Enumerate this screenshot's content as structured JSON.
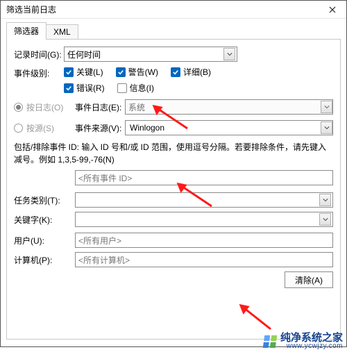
{
  "window": {
    "title": "筛选当前日志"
  },
  "tabs": {
    "filter": "筛选器",
    "xml": "XML"
  },
  "panel": {
    "logged_label": "记录时间(G):",
    "logged_value": "任何时间",
    "level_label": "事件级别:",
    "levels": {
      "critical": {
        "label": "关键(L)",
        "checked": true
      },
      "warning": {
        "label": "警告(W)",
        "checked": true
      },
      "verbose": {
        "label": "详细(B)",
        "checked": true
      },
      "error": {
        "label": "错误(R)",
        "checked": true
      },
      "info": {
        "label": "信息(I)",
        "checked": false
      }
    },
    "by_log": {
      "radio": "按日志(O)",
      "sublabel": "事件日志(E):",
      "value": "系统"
    },
    "by_source": {
      "radio": "按源(S)",
      "sublabel": "事件来源(V):",
      "value": "Winlogon"
    },
    "id_explain": "包括/排除事件 ID: 输入 ID 号和/或 ID 范围，使用逗号分隔。若要排除条件，请先键入减号。例如 1,3,5-99,-76(N)",
    "id_placeholder": "<所有事件 ID>",
    "task_label": "任务类别(T):",
    "keywords_label": "关键字(K):",
    "user_label": "用户(U):",
    "user_placeholder": "<所有用户>",
    "computer_label": "计算机(P):",
    "computer_placeholder": "<所有计算机>",
    "clear_label": "清除(A)"
  },
  "watermark": {
    "brand": "纯净系统之家",
    "url": "www.ycwjzy.com"
  }
}
